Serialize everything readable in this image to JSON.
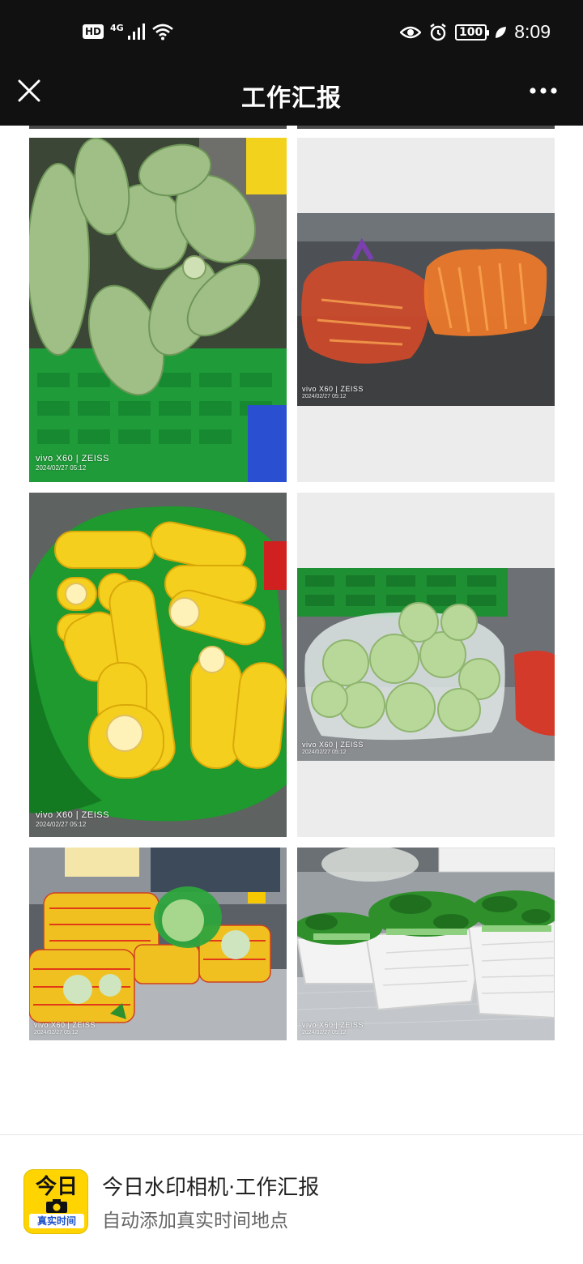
{
  "status_bar": {
    "hd": "HD",
    "network": "4G",
    "battery": "100",
    "time": "8:09"
  },
  "header": {
    "title": "工作汇报",
    "close_icon": "close-icon",
    "more_icon": "more-icon"
  },
  "photos": [
    {
      "subject": "zucchini in green crate",
      "brand": "vivo X60 | ZEISS",
      "date": "2024/02/27 05:12"
    },
    {
      "subject": "carrots in plastic bags",
      "brand": "vivo X60 | ZEISS",
      "date": "2024/02/27 05:12"
    },
    {
      "subject": "corn in green bag",
      "brand": "vivo X60 | ZEISS",
      "date": "2024/02/27 05:12"
    },
    {
      "subject": "cabbage in plastic bag",
      "brand": "vivo X60 | ZEISS",
      "date": "2024/02/27 05:12"
    },
    {
      "subject": "bagged vegetables on steel table",
      "brand": "vivo X60 | ZEISS",
      "date": "2024/02/27 05:12"
    },
    {
      "subject": "leafy greens in white baskets",
      "brand": "vivo X60 | ZEISS",
      "date": "2024/02/27 05:12"
    }
  ],
  "footer": {
    "logo_top": "今日",
    "logo_bottom": "真实时间",
    "title": "今日水印相机·工作汇报",
    "subtitle": "自动添加真实时间地点"
  },
  "colors": {
    "bar_bg": "#111111",
    "logo_yellow": "#ffd400",
    "logo_blue": "#1a50c8"
  }
}
